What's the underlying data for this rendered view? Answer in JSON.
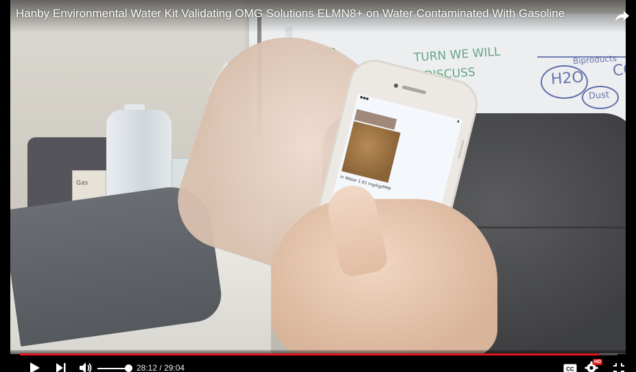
{
  "video": {
    "title": "Hanby Environmental Water Kit Validating OMG Solutions ELMN8+ on Water Contaminated With Gasoline",
    "whiteboard_lines": [
      "Ren",
      "TURN WE WILL",
      "DISCUSS",
      "Biproducts",
      "H2O",
      "CO",
      "Dust"
    ],
    "box_label": "Gas",
    "phone_screen": {
      "result_text": "in Water 1.61 mg/kg/PPM"
    }
  },
  "controls": {
    "current_time": "28:12",
    "duration": "29:04",
    "time_display": "28:12 / 29:04",
    "progress_fraction": 0.97,
    "volume_fraction": 0.83,
    "hd_badge": "HD",
    "icons": [
      "play-icon",
      "next-icon",
      "volume-icon",
      "cc-icon",
      "settings-icon",
      "fullscreen-exit-icon",
      "share-icon"
    ],
    "accent_color": "#e3141b"
  }
}
